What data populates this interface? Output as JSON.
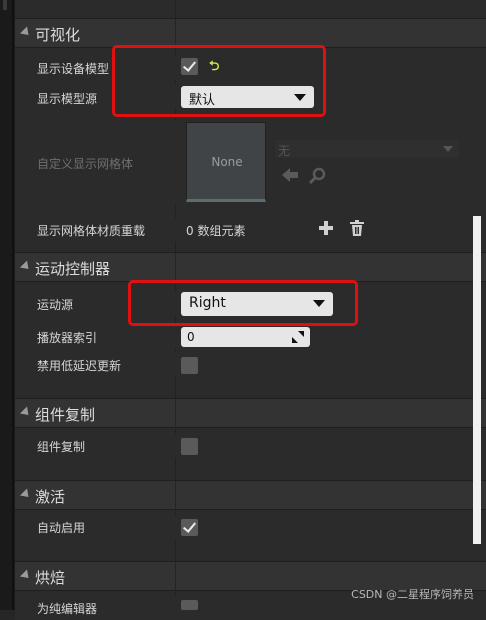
{
  "categories": {
    "visualization": "可视化",
    "motion_controller": "运动控制器",
    "component_replication": "组件复制",
    "activation": "激活",
    "cooking": "烘焙"
  },
  "rows": {
    "show_device_model": "显示设备模型",
    "display_model_source": "显示模型源",
    "custom_display_mesh": "自定义显示网格体",
    "display_mesh_material_overrides": "显示网格体材质重载",
    "motion_source": "运动源",
    "player_index": "播放器索引",
    "disable_low_latency_update": "禁用低延迟更新",
    "component_replicates": "组件复制",
    "auto_activate": "自动启用",
    "editor_only": "为纯编辑器"
  },
  "values": {
    "display_model_source": "默认",
    "mesh_thumbnail": "None",
    "mesh_asset": "无",
    "material_overrides": "0 数组元素",
    "motion_source": "Right",
    "player_index": "0",
    "show_device_model_checked": true,
    "disable_low_latency_update_checked": false,
    "component_replicates_checked": false,
    "auto_activate_checked": true
  },
  "icons": {
    "reset": "reset-to-default-icon",
    "browse": "arrow-left-icon",
    "search": "search-icon",
    "add": "plus-icon",
    "delete": "trash-icon"
  },
  "colors": {
    "highlight": "#e01010",
    "reset": "#d7e64a"
  },
  "watermark": "CSDN @二星程序饲养员"
}
